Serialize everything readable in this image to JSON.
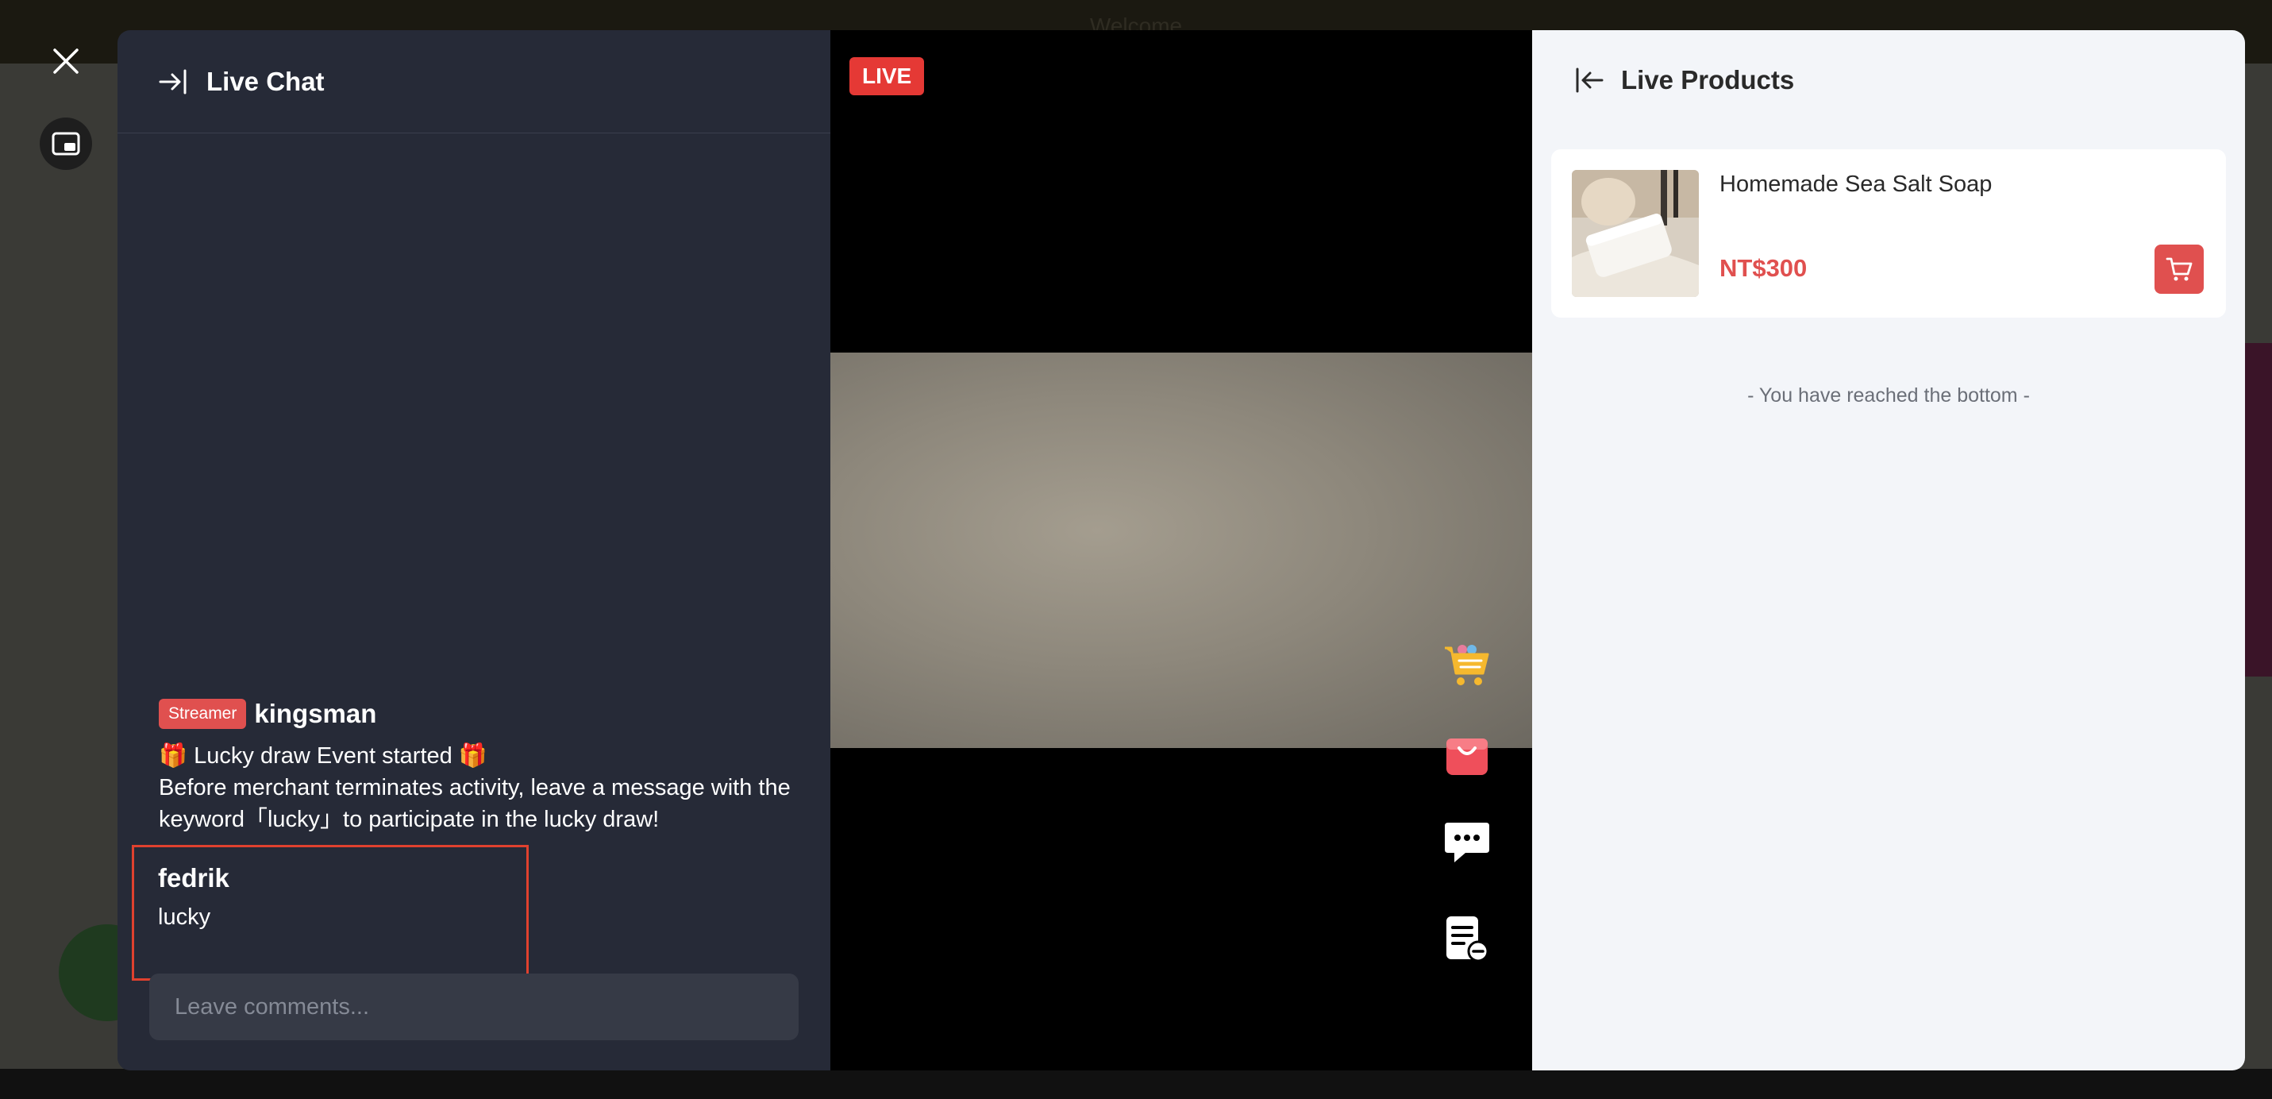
{
  "background": {
    "topbar_text": "Welcome"
  },
  "chat": {
    "title": "Live Chat",
    "streamer_message": {
      "badge": "Streamer",
      "username": "kingsman",
      "line1_gift_left": "🎁",
      "line1_text": " Lucky draw Event started ",
      "line1_gift_right": "🎁",
      "line2": "Before merchant terminates activity, leave a message with the keyword「lucky」to participate in the lucky draw!"
    },
    "user_message": {
      "username": "fedrik",
      "text": "lucky"
    },
    "input_placeholder": "Leave comments..."
  },
  "video": {
    "live_label": "LIVE",
    "icons": [
      "cart-icon",
      "shopping-bag-icon",
      "chat-bubble-icon",
      "notes-icon"
    ]
  },
  "products": {
    "title": "Live Products",
    "items": [
      {
        "name": "Homemade Sea Salt Soap",
        "price": "NT$300"
      }
    ],
    "bottom_note": "- You have reached the bottom -"
  },
  "colors": {
    "accent_red": "#e0504f",
    "chat_bg": "#262a37",
    "products_bg": "#f3f5f9",
    "highlight_border": "#e0412e"
  }
}
